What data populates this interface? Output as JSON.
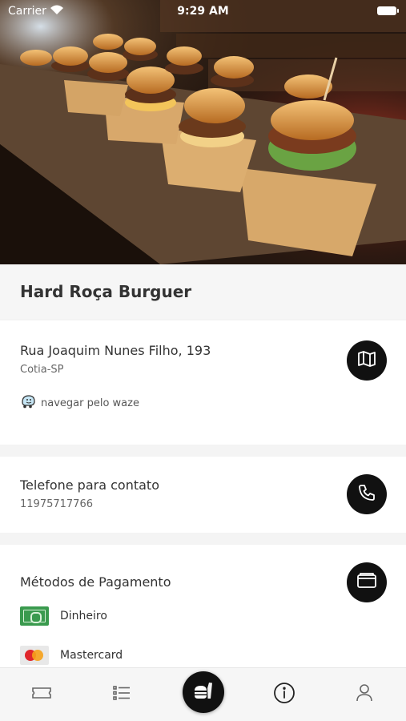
{
  "status_bar": {
    "carrier": "Carrier",
    "time": "9:29 AM"
  },
  "hero": {
    "image": "burgers-photo"
  },
  "restaurant": {
    "name": "Hard Roça Burguer"
  },
  "address": {
    "street": "Rua Joaquim Nunes Filho, 193",
    "city": "Cotia-SP",
    "waze_label": "navegar pelo waze",
    "map_button_icon": "map-icon"
  },
  "phone": {
    "label": "Telefone para contato",
    "number": "11975717766",
    "call_button_icon": "phone-icon"
  },
  "payment": {
    "title": "Métodos de Pagamento",
    "icon": "wallet-icon",
    "methods": [
      {
        "label": "Dinheiro",
        "icon": "cash-icon"
      },
      {
        "label": "Mastercard",
        "icon": "mastercard-icon"
      }
    ]
  },
  "tabbar": {
    "items": [
      "ticket-icon",
      "list-icon",
      "food-icon",
      "info-icon",
      "user-icon"
    ],
    "active": "food-icon",
    "accent": "#111111"
  }
}
